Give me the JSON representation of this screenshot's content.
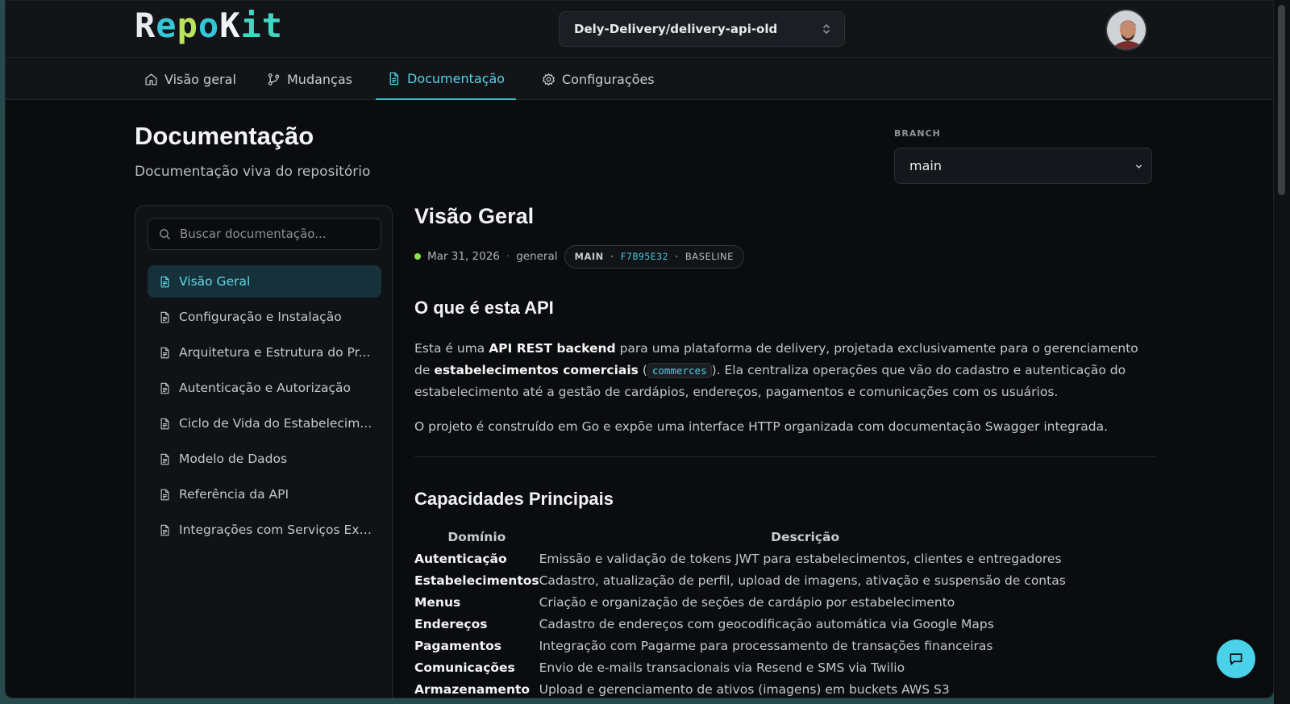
{
  "header": {
    "logo_text": [
      "R",
      "e",
      "p",
      "o",
      "K",
      "it"
    ],
    "repo_selector": "Dely-Delivery/delivery-api-old"
  },
  "tabs": [
    {
      "label": "Visão geral",
      "icon": "home-icon"
    },
    {
      "label": "Mudanças",
      "icon": "git-branch-icon"
    },
    {
      "label": "Documentação",
      "icon": "document-icon",
      "active": true
    },
    {
      "label": "Configurações",
      "icon": "gear-icon"
    }
  ],
  "page": {
    "title": "Documentação",
    "subtitle": "Documentação viva do repositório",
    "branch_label": "BRANCH",
    "branch_value": "main"
  },
  "sidebar": {
    "search_placeholder": "Buscar documentação...",
    "items": [
      {
        "label": "Visão Geral",
        "active": true
      },
      {
        "label": "Configuração e Instalação"
      },
      {
        "label": "Arquitetura e Estrutura do Pr..."
      },
      {
        "label": "Autenticação e Autorização"
      },
      {
        "label": "Ciclo de Vida do Estabelecim..."
      },
      {
        "label": "Modelo de Dados"
      },
      {
        "label": "Referência da API"
      },
      {
        "label": "Integrações com Serviços Ext..."
      }
    ]
  },
  "doc": {
    "title": "Visão Geral",
    "date": "Mar 31, 2026",
    "category": "general",
    "branch_tag": "MAIN",
    "commit": "F7B95E32",
    "baseline": "BASELINE",
    "section1_title": "O que é esta API",
    "p1_a": "Esta é uma ",
    "p1_b": "API REST backend",
    "p1_c": " para uma plataforma de delivery, projetada exclusivamente para o gerenciamento de ",
    "p1_d": "estabelecimentos comerciais",
    "p1_e": " (",
    "p1_code": "commerces",
    "p1_f": "). Ela centraliza operações que vão do cadastro e autenticação do estabelecimento até a gestão de cardápios, endereços, pagamentos e comunicações com os usuários.",
    "p2": "O projeto é construído em Go e expõe uma interface HTTP organizada com documentação Swagger integrada.",
    "section2_title": "Capacidades Principais",
    "table_headers": [
      "Domínio",
      "Descrição"
    ],
    "table_rows": [
      [
        "Autenticação",
        "Emissão e validação de tokens JWT para estabelecimentos, clientes e entregadores"
      ],
      [
        "Estabelecimentos",
        "Cadastro, atualização de perfil, upload de imagens, ativação e suspensão de contas"
      ],
      [
        "Menus",
        "Criação e organização de seções de cardápio por estabelecimento"
      ],
      [
        "Endereços",
        "Cadastro de endereços com geocodificação automática via Google Maps"
      ],
      [
        "Pagamentos",
        "Integração com Pagarme para processamento de transações financeiras"
      ],
      [
        "Comunicações",
        "Envio de e-mails transacionais via Resend e SMS via Twilio"
      ],
      [
        "Armazenamento",
        "Upload e gerenciamento de ativos (imagens) em buckets AWS S3"
      ]
    ]
  },
  "colors": {
    "accent": "#38bcd2",
    "background": "#0b0c0e",
    "status_dot": "#8fe24a"
  }
}
